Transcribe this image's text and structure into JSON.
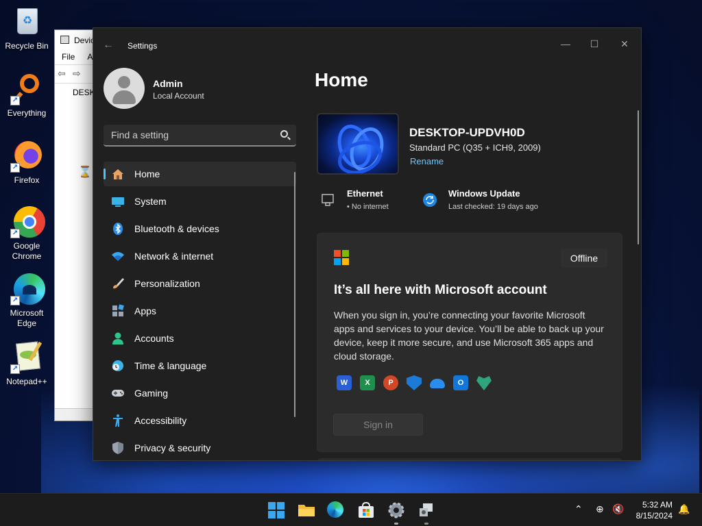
{
  "desktop": {
    "icons": [
      {
        "label": "Recycle Bin",
        "icon": "recycle-bin-icon"
      },
      {
        "label": "Everything",
        "icon": "everything-search-icon"
      },
      {
        "label": "Firefox",
        "icon": "firefox-icon"
      },
      {
        "label": "Google Chrome",
        "icon": "chrome-icon"
      },
      {
        "label": "Microsoft Edge",
        "icon": "edge-icon"
      },
      {
        "label": "Notepad++",
        "icon": "notepadpp-icon"
      }
    ]
  },
  "device_manager": {
    "title": "Devic",
    "menu": [
      "File",
      "Ac"
    ],
    "tree_root": "DESKT"
  },
  "settings": {
    "app_title": "Settings",
    "user": {
      "name": "Admin",
      "account_type": "Local Account"
    },
    "search": {
      "placeholder": "Find a setting"
    },
    "nav": [
      {
        "label": "Home",
        "icon": "home-icon",
        "active": true
      },
      {
        "label": "System",
        "icon": "system-monitor-icon"
      },
      {
        "label": "Bluetooth & devices",
        "icon": "bluetooth-icon"
      },
      {
        "label": "Network & internet",
        "icon": "wifi-icon"
      },
      {
        "label": "Personalization",
        "icon": "paintbrush-icon"
      },
      {
        "label": "Apps",
        "icon": "apps-icon"
      },
      {
        "label": "Accounts",
        "icon": "account-icon"
      },
      {
        "label": "Time & language",
        "icon": "clock-globe-icon"
      },
      {
        "label": "Gaming",
        "icon": "gamepad-icon"
      },
      {
        "label": "Accessibility",
        "icon": "accessibility-icon"
      },
      {
        "label": "Privacy & security",
        "icon": "shield-icon"
      }
    ],
    "main": {
      "title": "Home",
      "device": {
        "name": "DESKTOP-UPDVH0D",
        "model": "Standard PC (Q35 + ICH9, 2009)",
        "rename_label": "Rename"
      },
      "status": [
        {
          "title": "Ethernet",
          "subtitle": "• No internet",
          "icon": "ethernet-icon"
        },
        {
          "title": "Windows Update",
          "subtitle": "Last checked: 19 days ago",
          "icon": "windows-update-icon"
        }
      ],
      "account_card": {
        "badge": "Offline",
        "title": "It’s all here with Microsoft account",
        "body": "When you sign in, you’re connecting your favorite Microsoft apps and services to your device. You’ll be able to back up your device, keep it more secure, and use Microsoft 365 apps and cloud storage.",
        "app_icons": [
          "word-icon",
          "excel-icon",
          "powerpoint-icon",
          "defender-icon",
          "onedrive-icon",
          "outlook-icon",
          "family-safety-icon"
        ],
        "sign_in_label": "Sign in"
      }
    }
  },
  "taskbar": {
    "apps": [
      "start-icon",
      "file-explorer-icon",
      "edge-icon",
      "store-icon",
      "settings-icon",
      "device-manager-icon"
    ],
    "clock": {
      "time": "5:32 AM",
      "date": "8/15/2024"
    }
  },
  "colors": {
    "accent": "#4cc2ff",
    "window_bg": "#202020",
    "card_bg": "#2b2b2b"
  }
}
